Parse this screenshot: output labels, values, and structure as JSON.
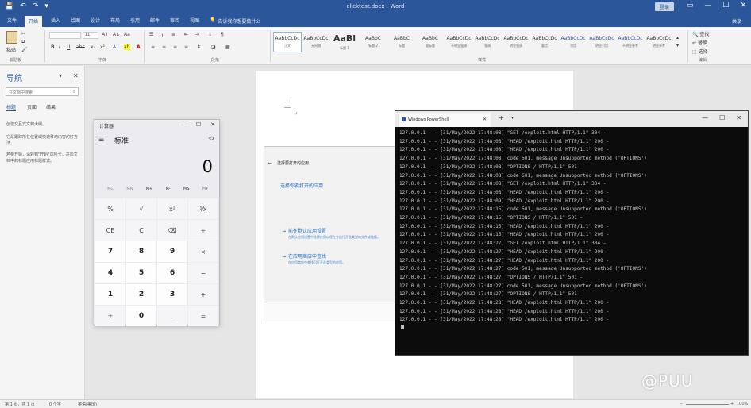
{
  "word": {
    "title": "clicktest.docx - Word",
    "qa": [
      "💾",
      "↶",
      "↷",
      "▾"
    ],
    "signin": "登录",
    "window_controls": [
      "▭",
      "—",
      "☐",
      "✕"
    ],
    "tabs": [
      "文件",
      "开始",
      "插入",
      "绘图",
      "设计",
      "布局",
      "引用",
      "邮件",
      "审阅",
      "视图",
      "帮助"
    ],
    "active_tab": "开始",
    "tell_me": "告诉我你想要做什么",
    "share": "共享",
    "ribbon": {
      "paste": "粘贴",
      "clipboard": "剪贴板",
      "font": "字体",
      "paragraph": "段落",
      "styles": "样式",
      "editing": "编辑",
      "find": "查找",
      "replace": "替换",
      "select": "选择",
      "font_size": "11",
      "style_tiles": [
        {
          "sample": "AaBbCcDc",
          "name": "正文",
          "big": false,
          "blue": false,
          "sel": true
        },
        {
          "sample": "AaBbCcDc",
          "name": "无间隔",
          "big": false,
          "blue": false,
          "sel": false
        },
        {
          "sample": "AaBl",
          "name": "标题 1",
          "big": true,
          "blue": false,
          "sel": false
        },
        {
          "sample": "AaBbC",
          "name": "标题 2",
          "big": false,
          "blue": false,
          "sel": false
        },
        {
          "sample": "AaBbC",
          "name": "标题",
          "big": false,
          "blue": false,
          "sel": false
        },
        {
          "sample": "AaBbC",
          "name": "副标题",
          "big": false,
          "blue": false,
          "sel": false
        },
        {
          "sample": "AaBbCcDc",
          "name": "不明显强调",
          "big": false,
          "blue": false,
          "sel": false
        },
        {
          "sample": "AaBbCcDc",
          "name": "强调",
          "big": false,
          "blue": false,
          "sel": false
        },
        {
          "sample": "AaBbCcDc",
          "name": "明显强调",
          "big": false,
          "blue": false,
          "sel": false
        },
        {
          "sample": "AaBbCcDc",
          "name": "要点",
          "big": false,
          "blue": false,
          "sel": false
        },
        {
          "sample": "AaBbCcDc",
          "name": "引用",
          "big": false,
          "blue": true,
          "sel": false
        },
        {
          "sample": "AaBbCcDc",
          "name": "明显引用",
          "big": false,
          "blue": true,
          "sel": false
        },
        {
          "sample": "AaBbCcDc",
          "name": "不明显参考",
          "big": false,
          "blue": true,
          "sel": false
        },
        {
          "sample": "AaBbCcDc",
          "name": "明显参考",
          "big": false,
          "blue": false,
          "sel": false
        }
      ]
    },
    "nav": {
      "title": "导航",
      "search_placeholder": "在文档中搜索",
      "tabs": [
        "标题",
        "页面",
        "结果"
      ],
      "para1": "创建交互式文档大纲。",
      "para2": "它是跟踪所在位置或快速移动内容的好方法。",
      "para3": "若要开始，请转到\"开始\"选项卡，并向文档中的标题应用标题样式。"
    },
    "status": {
      "page": "第 1 页，共 1 页",
      "words": "0 个字",
      "lang": "英语(美国)",
      "zoom": "100%"
    }
  },
  "calculator": {
    "title": "计算器",
    "mode": "标准",
    "display": "0",
    "memory": [
      "MC",
      "MR",
      "M+",
      "M-",
      "MS",
      "M▾"
    ],
    "keys": [
      {
        "l": "%",
        "t": "op"
      },
      {
        "l": "√",
        "t": "op"
      },
      {
        "l": "x²",
        "t": "op"
      },
      {
        "l": "⅟x",
        "t": "op"
      },
      {
        "l": "CE",
        "t": "op"
      },
      {
        "l": "C",
        "t": "op"
      },
      {
        "l": "⌫",
        "t": "op"
      },
      {
        "l": "÷",
        "t": "op"
      },
      {
        "l": "7",
        "t": "num"
      },
      {
        "l": "8",
        "t": "num"
      },
      {
        "l": "9",
        "t": "num"
      },
      {
        "l": "×",
        "t": "op"
      },
      {
        "l": "4",
        "t": "num"
      },
      {
        "l": "5",
        "t": "num"
      },
      {
        "l": "6",
        "t": "num"
      },
      {
        "l": "−",
        "t": "op"
      },
      {
        "l": "1",
        "t": "num"
      },
      {
        "l": "2",
        "t": "num"
      },
      {
        "l": "3",
        "t": "num"
      },
      {
        "l": "+",
        "t": "op"
      },
      {
        "l": "±",
        "t": "op"
      },
      {
        "l": "0",
        "t": "num"
      },
      {
        "l": ".",
        "t": "op"
      },
      {
        "l": "=",
        "t": "op"
      }
    ]
  },
  "settings": {
    "title": "选择要打开的应用",
    "heading": "选择你要打开的应用",
    "link1": "前往默认应用设置",
    "desc1": "在默认应用设置中选择应用以便在今后打开此类型的文件或链接。",
    "link2": "在应用商店中查找",
    "desc2": "在应用商店中查找可打开此类型的应用。"
  },
  "terminal": {
    "tab_title": "Windows PowerShell",
    "lines": [
      "127.0.0.1 - - [31/May/2022 17:48:08] \"GET /exploit.html HTTP/1.1\" 304 -",
      "127.0.0.1 - - [31/May/2022 17:48:08] \"HEAD /exploit.html HTTP/1.1\" 200 -",
      "127.0.0.1 - - [31/May/2022 17:48:08] \"HEAD /exploit.html HTTP/1.1\" 200 -",
      "127.0.0.1 - - [31/May/2022 17:48:08] code 501, message Unsupported method ('OPTIONS')",
      "127.0.0.1 - - [31/May/2022 17:48:08] \"OPTIONS / HTTP/1.1\" 501 -",
      "127.0.0.1 - - [31/May/2022 17:48:08] code 501, message Unsupported method ('OPTIONS')",
      "127.0.0.1 - - [31/May/2022 17:48:08] \"GET /exploit.html HTTP/1.1\" 304 -",
      "127.0.0.1 - - [31/May/2022 17:48:08] \"HEAD /exploit.html HTTP/1.1\" 200 -",
      "127.0.0.1 - - [31/May/2022 17:48:09] \"HEAD /exploit.html HTTP/1.1\" 200 -",
      "127.0.0.1 - - [31/May/2022 17:48:15] code 501, message Unsupported method ('OPTIONS')",
      "127.0.0.1 - - [31/May/2022 17:48:15] \"OPTIONS / HTTP/1.1\" 501 -",
      "127.0.0.1 - - [31/May/2022 17:48:15] \"HEAD /exploit.html HTTP/1.1\" 200 -",
      "127.0.0.1 - - [31/May/2022 17:48:15] \"HEAD /exploit.html HTTP/1.1\" 200 -",
      "127.0.0.1 - - [31/May/2022 17:48:27] \"GET /exploit.html HTTP/1.1\" 304 -",
      "127.0.0.1 - - [31/May/2022 17:48:27] \"HEAD /exploit.html HTTP/1.1\" 200 -",
      "127.0.0.1 - - [31/May/2022 17:48:27] \"HEAD /exploit.html HTTP/1.1\" 200 -",
      "127.0.0.1 - - [31/May/2022 17:48:27] code 501, message Unsupported method ('OPTIONS')",
      "127.0.0.1 - - [31/May/2022 17:48:27] \"OPTIONS / HTTP/1.1\" 501 -",
      "127.0.0.1 - - [31/May/2022 17:48:27] code 501, message Unsupported method ('OPTIONS')",
      "127.0.0.1 - - [31/May/2022 17:48:27] \"OPTIONS / HTTP/1.1\" 501 -",
      "127.0.0.1 - - [31/May/2022 17:48:28] \"HEAD /exploit.html HTTP/1.1\" 200 -",
      "127.0.0.1 - - [31/May/2022 17:48:28] \"HEAD /exploit.html HTTP/1.1\" 200 -",
      "127.0.0.1 - - [31/May/2022 17:48:28] \"HEAD /exploit.html HTTP/1.1\" 200 -"
    ]
  },
  "watermark": "@PUU"
}
